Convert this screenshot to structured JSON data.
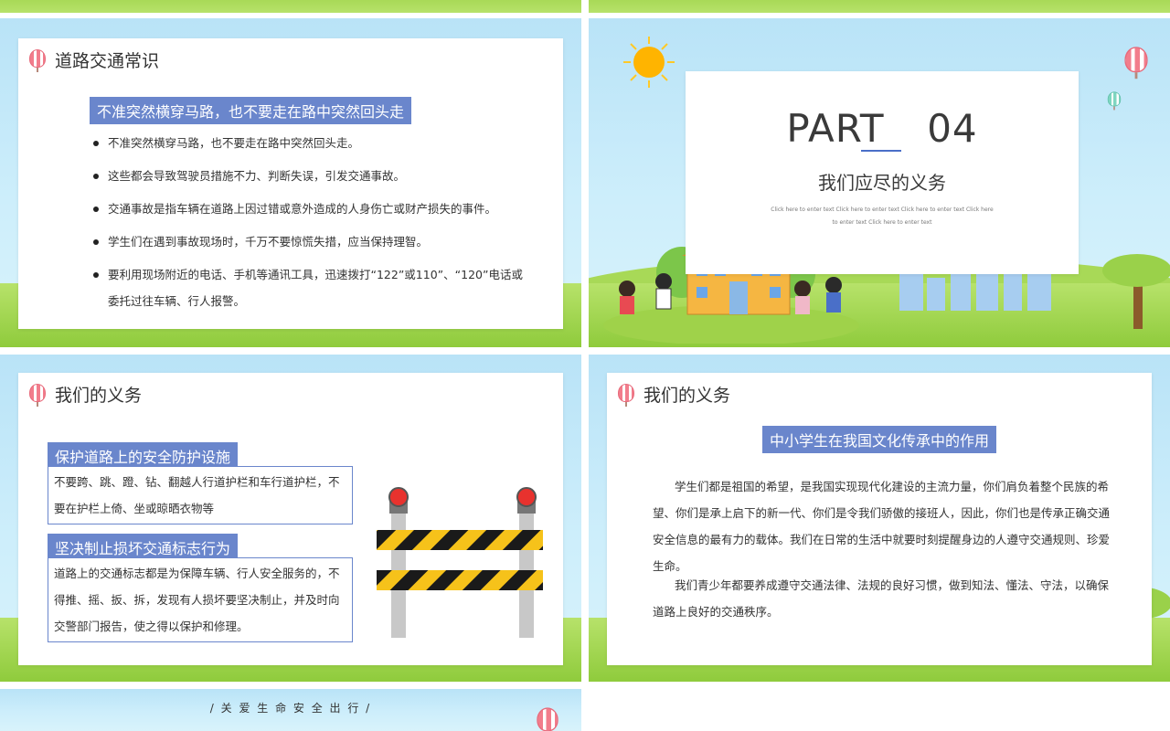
{
  "slide1": {
    "title": "道路交通常识",
    "heading": "不准突然横穿马路，也不要走在路中突然回头走",
    "bullets": [
      "不准突然横穿马路，也不要走在路中突然回头走。",
      "这些都会导致驾驶员措施不力、判断失误，引发交通事故。",
      "交通事故是指车辆在道路上因过错或意外造成的人身伤亡或财产损失的事件。",
      "学生们在遇到事故现场时，千万不要惊慌失措，应当保持理智。",
      "要利用现场附近的电话、手机等通讯工具，迅速拨打“122”或110”、“120”电话或委托过往车辆、行人报警。"
    ]
  },
  "slide2": {
    "part_label": "PART",
    "part_number": "04",
    "subtitle": "我们应尽的义务",
    "placeholder_line1": "Click here to enter text   Click here to enter text   Click here to enter text   Click here",
    "placeholder_line2": "to enter text   Click here to enter text"
  },
  "slide3": {
    "title": "我们的义务",
    "section1_heading": "保护道路上的安全防护设施",
    "section1_body": "不要跨、跳、蹬、钻、翻越人行道护栏和车行道护栏，不要在护栏上倚、坐或晾晒衣物等",
    "section2_heading": "坚决制止损坏交通标志行为",
    "section2_body": "道路上的交通标志都是为保障车辆、行人安全服务的，不得推、摇、扳、拆，发现有人损坏要坚决制止，并及时向交警部门报告，使之得以保护和修理。"
  },
  "slide4": {
    "title": "我们的义务",
    "heading": "中小学生在我国文化传承中的作用",
    "paragraph1": "学生们都是祖国的希望，是我国实现现代化建设的主流力量，你们肩负着整个民族的希望、你们是承上启下的新一代、你们是令我们骄傲的接班人，因此，你们也是传承正确交通安全信息的最有力的载体。我们在日常的生活中就要时刻提醒身边的人遵守交通规则、珍爱生命。",
    "paragraph2": "我们青少年都要养成遵守交通法律、法规的良好习惯，做到知法、懂法、守法，以确保道路上良好的交通秩序。"
  },
  "slide5": {
    "tagline": "/ 关 爱 生 命 安 全 出 行 /"
  },
  "colors": {
    "accent_blue": "#6a86cc",
    "sky": "#b9e3f7",
    "grass": "#8fcb3c"
  }
}
